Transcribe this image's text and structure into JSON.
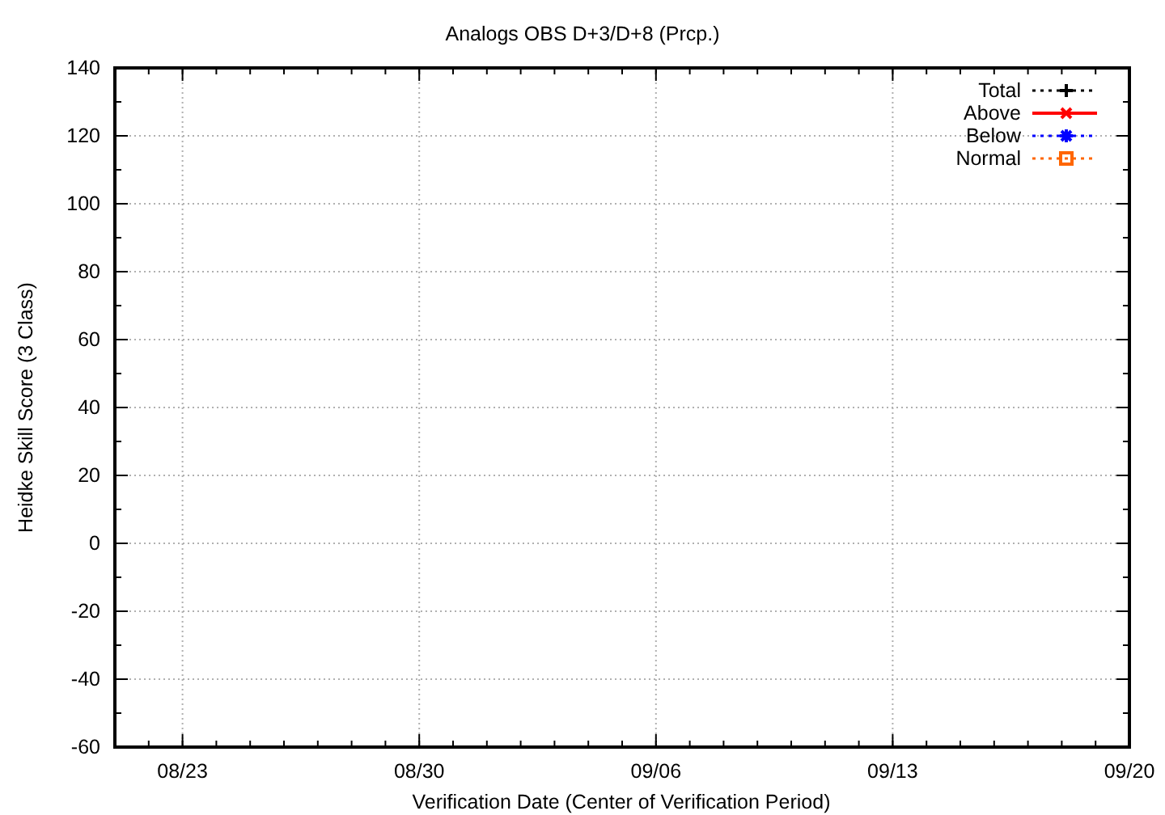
{
  "chart_data": {
    "type": "line",
    "title": "Analogs OBS D+3/D+8 (Prcp.)",
    "xlabel": "Verification Date (Center of Verification Period)",
    "ylabel": "Heidke Skill Score (3 Class)",
    "categories": [
      "08/23",
      "08/30",
      "09/06",
      "09/13",
      "09/20"
    ],
    "ylim": [
      -60,
      140
    ],
    "yticks": [
      -60,
      -40,
      -20,
      0,
      20,
      40,
      60,
      80,
      100,
      120,
      140
    ],
    "grid": true,
    "series": [
      {
        "name": "Total",
        "color": "#000000",
        "values": [
          null,
          null,
          null,
          null,
          null
        ]
      },
      {
        "name": "Above",
        "color": "#ff0000",
        "values": [
          null,
          null,
          null,
          null,
          null
        ]
      },
      {
        "name": "Below",
        "color": "#0000ff",
        "values": [
          null,
          null,
          null,
          null,
          null
        ]
      },
      {
        "name": "Normal",
        "color": "#ff6600",
        "values": [
          null,
          null,
          null,
          null,
          null
        ]
      }
    ]
  }
}
